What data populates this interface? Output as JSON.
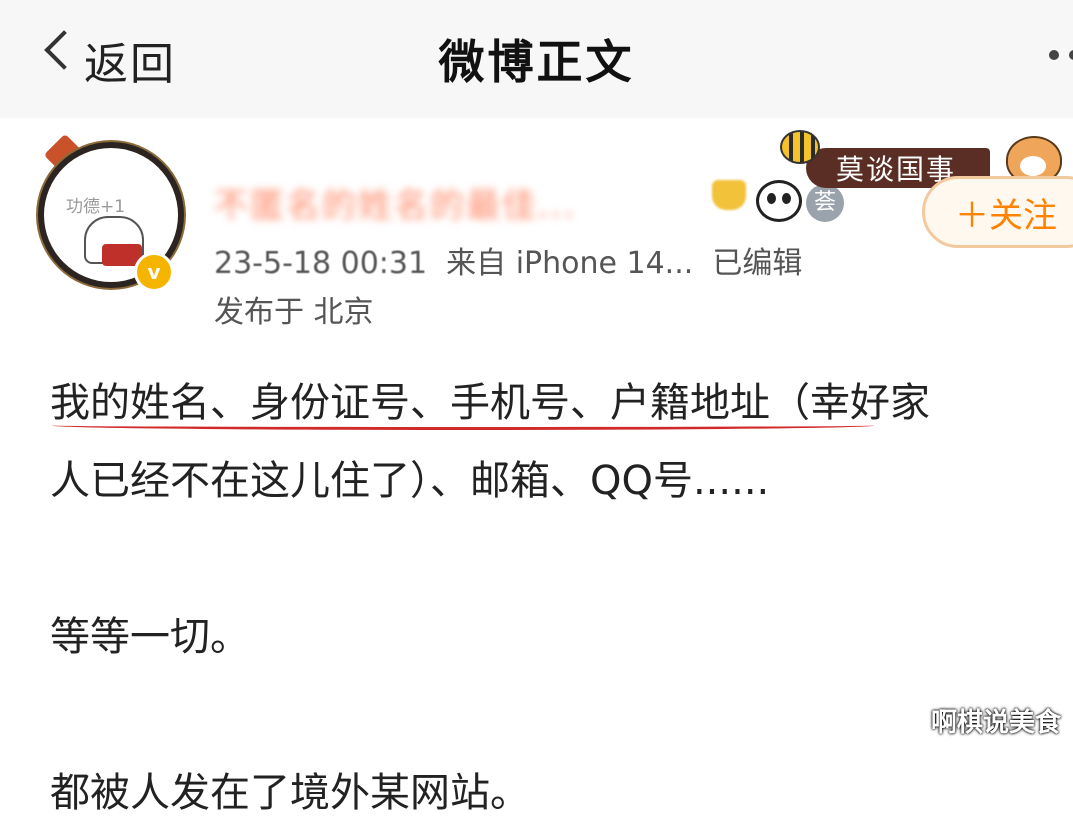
{
  "nav": {
    "back_label": "返回",
    "title": "微博正文",
    "more_icon": "more-dots-icon"
  },
  "user": {
    "avatar_text": "功德+1",
    "name": "不匿名的姓名的最佳...",
    "badges": [
      "crown-icon",
      "panda-icon",
      "tag-icon"
    ],
    "tag_text": "荟",
    "verified_icon": "verified-badge-icon",
    "verified_mark": "v"
  },
  "meta": {
    "time": "23-5-18 00:31",
    "source": "来自 iPhone 14...",
    "edited": "已编辑",
    "location": "发布于 北京"
  },
  "banner": {
    "text": "莫谈国事"
  },
  "follow": {
    "label": "＋关注"
  },
  "post": {
    "line1": "我的姓名、身份证号、手机号、户籍地址（幸好家",
    "line2": "人已经不在这儿住了）、邮箱、QQ号......",
    "line3": "等等一切。",
    "line4": "都被人发在了境外某网站。"
  },
  "watermark": "啊棋说美食",
  "colors": {
    "accent": "#ff8200",
    "underline": "#d02a2a"
  }
}
